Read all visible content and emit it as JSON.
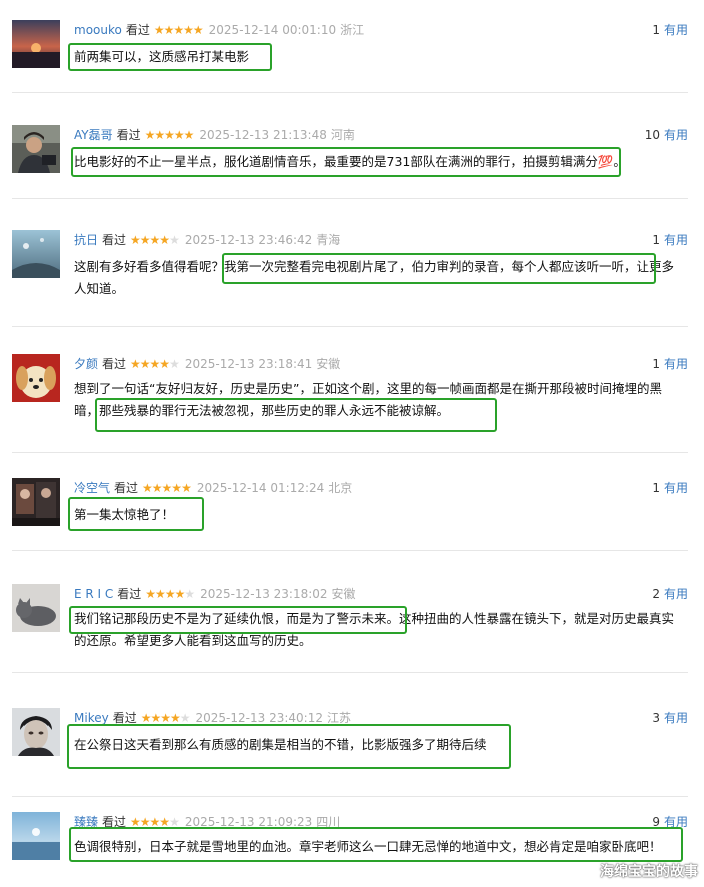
{
  "reviews": [
    {
      "user": "moouko",
      "watched": "看过",
      "rating": 5,
      "time": "2025-12-14 00:01:10",
      "location": "浙江",
      "useful_count": "1",
      "useful_label": "有用",
      "text": "前两集可以，这质感吊打某电影",
      "avatar": "sunset-avatar-icon"
    },
    {
      "user": "AY磊哥",
      "watched": "看过",
      "rating": 5,
      "time": "2025-12-13 21:13:48",
      "location": "河南",
      "useful_count": "10",
      "useful_label": "有用",
      "text": "比电影好的不止一星半点，服化道剧情音乐，最重要的是731部队在满洲的罪行，拍摄剪辑满分💯。",
      "avatar": "man-avatar-icon"
    },
    {
      "user": "抗日",
      "watched": "看过",
      "rating": 4,
      "time": "2025-12-13 23:46:42",
      "location": "青海",
      "useful_count": "1",
      "useful_label": "有用",
      "text": "这剧有多好看多值得看呢？我第一次完整看完电视剧片尾了，伯力审判的录音，每个人都应该听一听，让更多人知道。",
      "avatar": "sky-avatar-icon"
    },
    {
      "user": "夕颜",
      "watched": "看过",
      "rating": 4,
      "time": "2025-12-13 23:18:41",
      "location": "安徽",
      "useful_count": "1",
      "useful_label": "有用",
      "text": "想到了一句话“友好归友好，历史是历史”，正如这个剧，这里的每一帧画面都是在撕开那段被时间掩埋的黑暗，那些残暴的罪行无法被忽视，那些历史的罪人永远不能被谅解。",
      "avatar": "dog-avatar-icon"
    },
    {
      "user": "冷空气",
      "watched": "看过",
      "rating": 5,
      "time": "2025-12-14 01:12:24",
      "location": "北京",
      "useful_count": "1",
      "useful_label": "有用",
      "text": "第一集太惊艳了！",
      "avatar": "photo-avatar-icon"
    },
    {
      "user": "E R I C",
      "watched": "看过",
      "rating": 4,
      "time": "2025-12-13 23:18:02",
      "location": "安徽",
      "useful_count": "2",
      "useful_label": "有用",
      "text": "我们铭记那段历史不是为了延续仇恨，而是为了警示未来。这种扭曲的人性暴露在镜头下，就是对历史最真实的还原。希望更多人能看到这血写的历史。",
      "avatar": "cat-avatar-icon"
    },
    {
      "user": "Mikey",
      "watched": "看过",
      "rating": 4,
      "time": "2025-12-13 23:40:12",
      "location": "江苏",
      "useful_count": "3",
      "useful_label": "有用",
      "text": "在公祭日这天看到那么有质感的剧集是相当的不错，比影版强多了期待后续",
      "avatar": "face-avatar-icon"
    },
    {
      "user": "臻臻",
      "watched": "看过",
      "rating": 4,
      "time": "2025-12-13 21:09:23",
      "location": "四川",
      "useful_count": "9",
      "useful_label": "有用",
      "text": "色调很特别，日本子就是雪地里的血池。章宇老师这么一口肆无忌惮的地道中文，想必肯定是咱家卧底吧！",
      "avatar": "sea-avatar-icon"
    }
  ],
  "watermark": "海绵宝宝的故事"
}
